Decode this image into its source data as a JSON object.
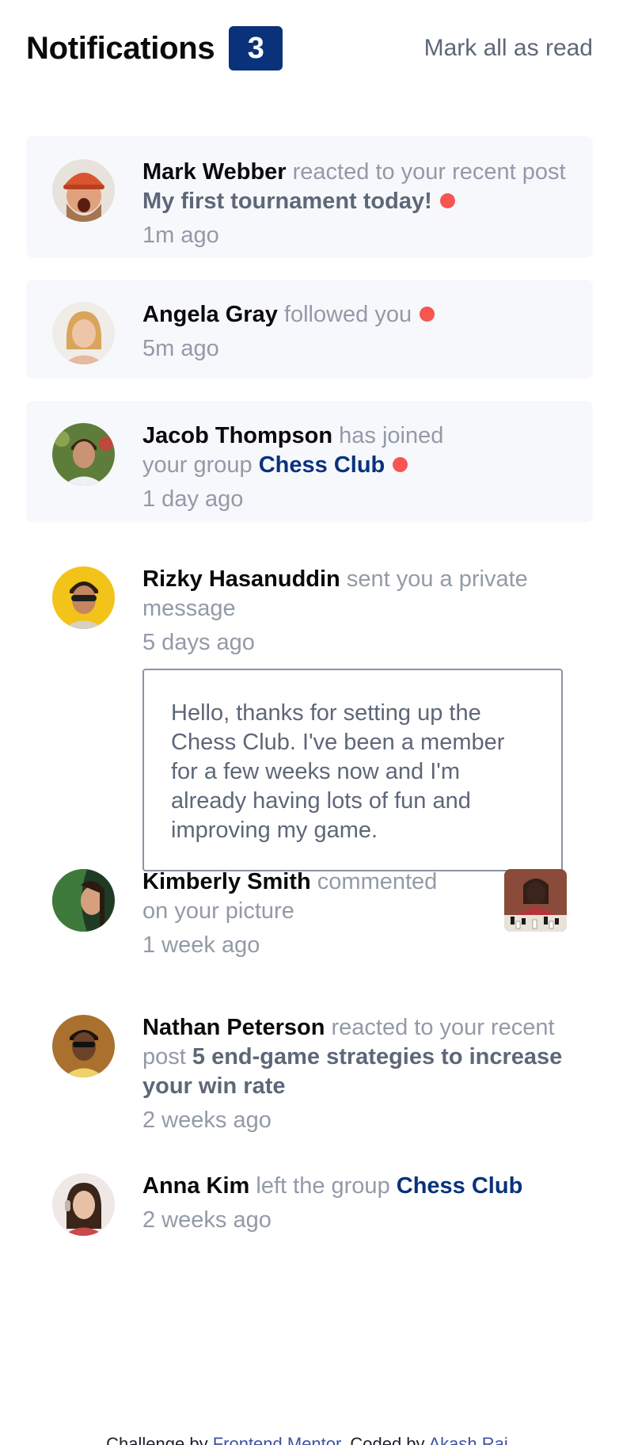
{
  "header": {
    "title": "Notifications",
    "unread_count": "3",
    "mark_all_label": "Mark all as read"
  },
  "notifications": [
    {
      "name": "Mark Webber",
      "action": "reacted to your recent post",
      "target": "My first tournament today!",
      "target_type": "post",
      "time": "1m ago",
      "unread": true,
      "avatar_icon": "avatar-mark-webber"
    },
    {
      "name": "Angela Gray",
      "action": "followed you",
      "target": "",
      "time": "5m ago",
      "unread": true,
      "avatar_icon": "avatar-angela-gray"
    },
    {
      "name": "Jacob Thompson",
      "action": "has joined your group",
      "target": "Chess Club",
      "target_type": "group",
      "time": "1 day ago",
      "unread": true,
      "avatar_icon": "avatar-jacob-thompson"
    },
    {
      "name": "Rizky Hasanuddin",
      "action": "sent you a private message",
      "target": "",
      "time": "5 days ago",
      "unread": false,
      "message": "Hello, thanks for setting up the Chess Club. I've been a member for a few weeks now and I'm already having lots of fun and improving my game.",
      "avatar_icon": "avatar-rizky-hasanuddin"
    },
    {
      "name": "Kimberly Smith",
      "action": "commented on your picture",
      "target": "",
      "time": "1 week ago",
      "unread": false,
      "picture_icon": "chess-picture-thumbnail",
      "avatar_icon": "avatar-kimberly-smith"
    },
    {
      "name": "Nathan Peterson",
      "action": "reacted to your recent post",
      "target": "5 end-game strategies to increase your win rate",
      "target_type": "post",
      "time": "2 weeks ago",
      "unread": false,
      "avatar_icon": "avatar-nathan-peterson"
    },
    {
      "name": "Anna Kim",
      "action": "left the group",
      "target": "Chess Club",
      "target_type": "group",
      "time": "2 weeks ago",
      "unread": false,
      "avatar_icon": "avatar-anna-kim"
    }
  ],
  "footer": {
    "prefix": "Challenge by",
    "link1": "Frontend Mentor",
    "middle": ". Coded by",
    "link2": "Akash Raj",
    "suffix": "."
  },
  "colors": {
    "badge": "#0a327b",
    "unread_bg": "#f6f8fc",
    "dot": "#f65552",
    "group": "#0a327b",
    "muted": "#939aa7"
  }
}
